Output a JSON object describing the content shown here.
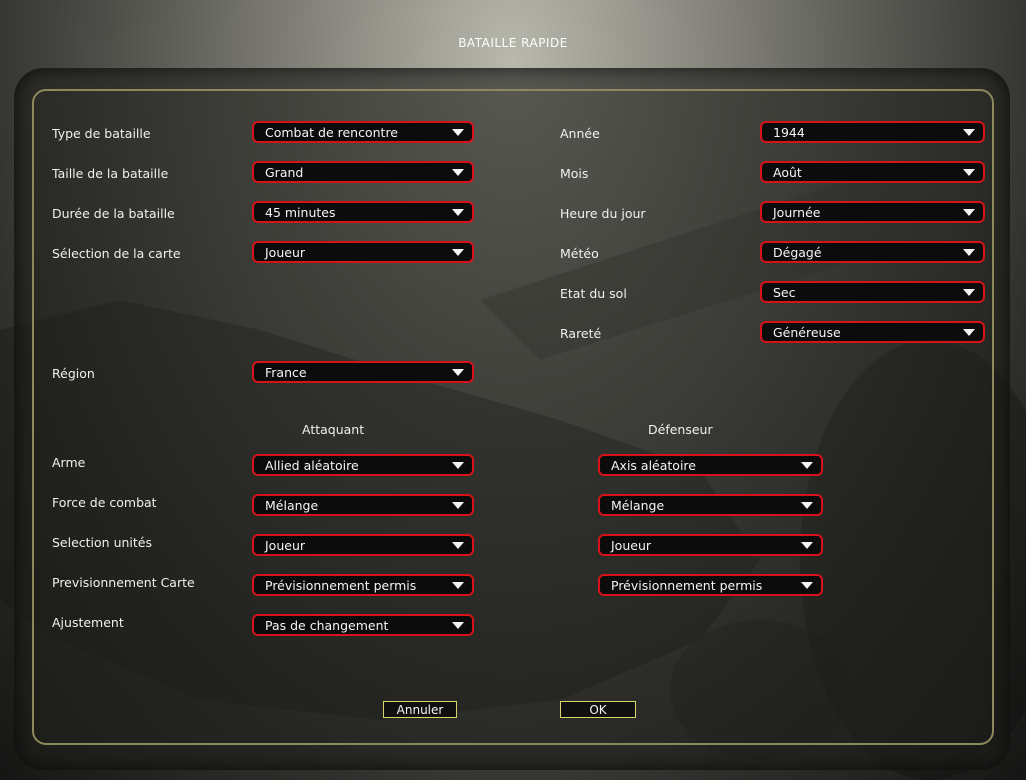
{
  "window": {
    "title": "BATAILLE RAPIDE"
  },
  "left_fields": [
    {
      "label": "Type de bataille",
      "value": "Combat de rencontre"
    },
    {
      "label": "Taille de la bataille",
      "value": "Grand"
    },
    {
      "label": "Durée de la bataille",
      "value": "45 minutes"
    },
    {
      "label": "Sélection de la carte",
      "value": "Joueur"
    }
  ],
  "region": {
    "label": "Région",
    "value": "France"
  },
  "right_fields": [
    {
      "label": "Année",
      "value": "1944"
    },
    {
      "label": "Mois",
      "value": "Août"
    },
    {
      "label": "Heure du jour",
      "value": "Journée"
    },
    {
      "label": "Météo",
      "value": "Dégagé"
    },
    {
      "label": "Etat du sol",
      "value": "Sec"
    },
    {
      "label": "Rareté",
      "value": "Généreuse"
    }
  ],
  "sides": {
    "attacker_header": "Attaquant",
    "defender_header": "Défenseur",
    "rows": [
      {
        "label": "Arme",
        "attacker": "Allied aléatoire",
        "defender": "Axis aléatoire"
      },
      {
        "label": "Force de combat",
        "attacker": "Mélange",
        "defender": "Mélange"
      },
      {
        "label": "Selection unités",
        "attacker": "Joueur",
        "defender": "Joueur"
      },
      {
        "label": "Previsionnement Carte",
        "attacker": "Prévisionnement permis",
        "defender": "Prévisionnement permis"
      },
      {
        "label": "Ajustement",
        "attacker": "Pas de changement"
      }
    ]
  },
  "buttons": {
    "cancel": "Annuler",
    "ok": "OK"
  },
  "colors": {
    "dropdown_border": "#d8121b",
    "frame": "#8c8a5a",
    "button_border": "#d7d46a"
  }
}
